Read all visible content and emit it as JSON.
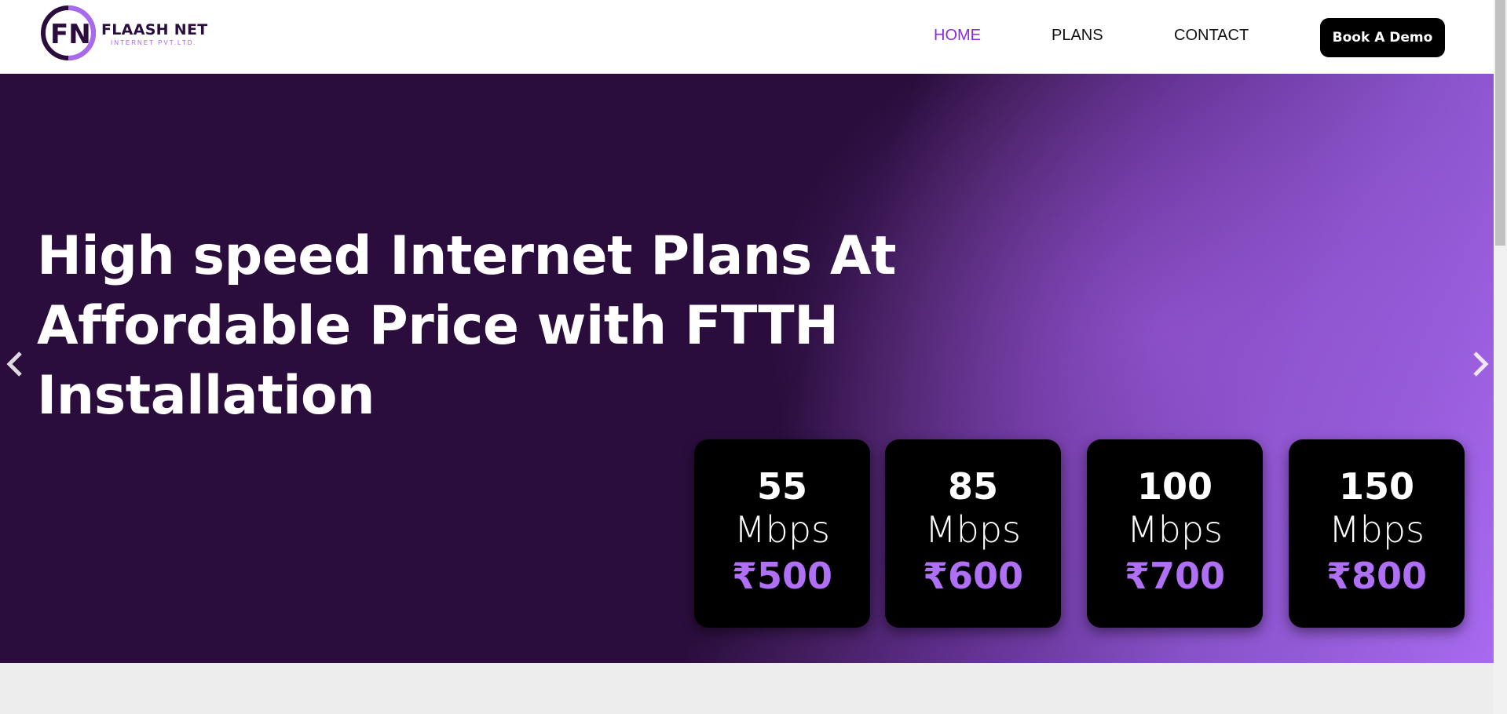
{
  "header": {
    "logo": {
      "initials": "FN",
      "name": "FLAASH NET",
      "subtitle": "INTERNET PVT.LTD."
    },
    "nav": [
      {
        "label": "HOME",
        "active": true
      },
      {
        "label": "PLANS",
        "active": false
      },
      {
        "label": "CONTACT",
        "active": false
      }
    ],
    "cta_label": "Book A Demo"
  },
  "hero": {
    "title_lines": [
      "High speed Internet Plans At",
      "Affordable Price with FTTH",
      "Installation"
    ],
    "prev_icon": "chevron-left-icon",
    "next_icon": "chevron-right-icon",
    "plans": [
      {
        "speed": "55",
        "unit": "Mbps",
        "price": "₹500"
      },
      {
        "speed": "85",
        "unit": "Mbps",
        "price": "₹600"
      },
      {
        "speed": "100",
        "unit": "Mbps",
        "price": "₹700"
      },
      {
        "speed": "150",
        "unit": "Mbps",
        "price": "₹800"
      }
    ]
  },
  "colors": {
    "accent": "#8a2be2",
    "hero_dark": "#2a0d3d",
    "hero_light": "#a86af0",
    "price": "#b070f5",
    "button_bg": "#000000"
  }
}
